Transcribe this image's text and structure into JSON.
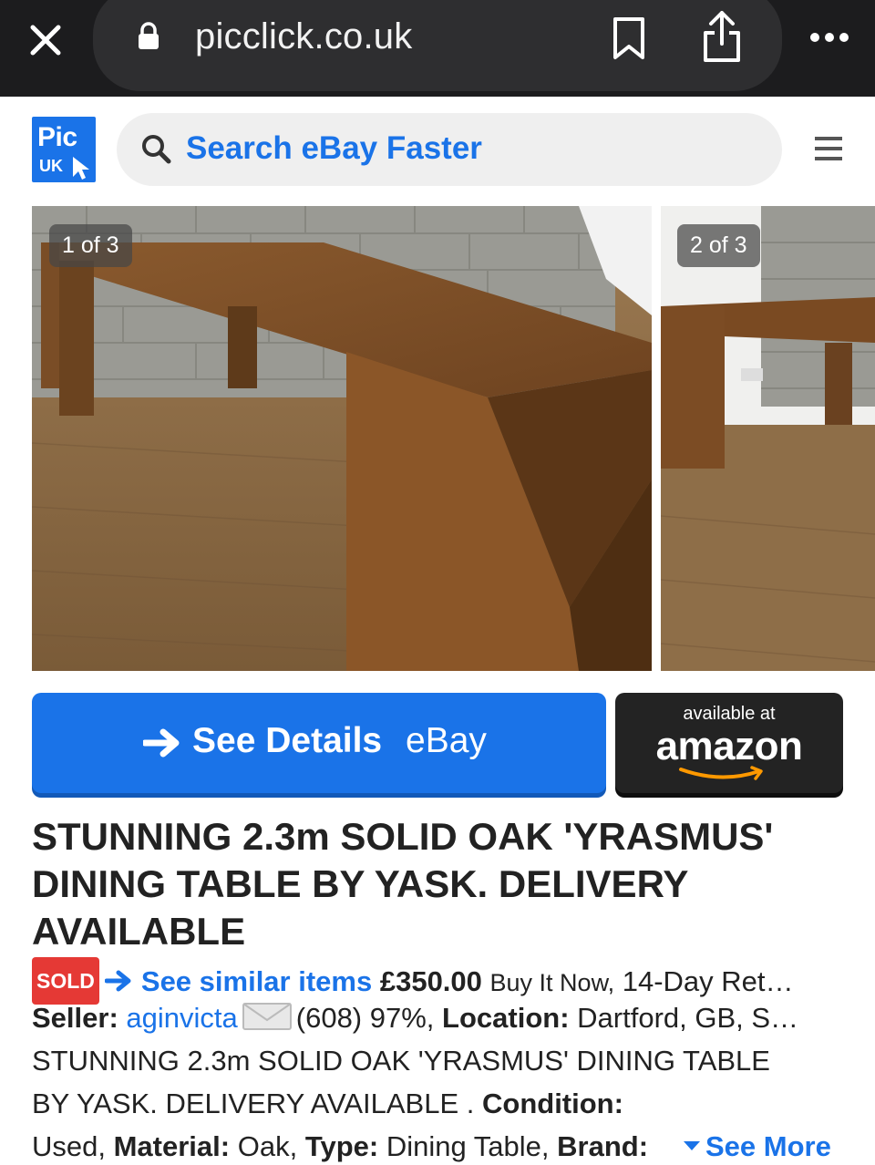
{
  "browser": {
    "url": "picclick.co.uk"
  },
  "header": {
    "logo_top": "Pic",
    "logo_bottom": "UK",
    "search_placeholder": "Search eBay Faster"
  },
  "gallery": {
    "photos": [
      {
        "counter": "1 of 3"
      },
      {
        "counter": "2 of 3"
      }
    ]
  },
  "actions": {
    "details_label": "See Details",
    "details_source": "eBay",
    "amazon_small": "available at",
    "amazon_logo": "amazon"
  },
  "listing": {
    "title": "STUNNING 2.3m SOLID OAK 'YRASMUS' DINING TABLE BY YASK. DELIVERY AVAILABLE",
    "sold_badge": "SOLD",
    "similar_link": "See similar items",
    "price": "£350.00",
    "buy_type": "Buy It Now,",
    "returns": "14-Day Ret…",
    "seller_label": "Seller:",
    "seller_name": "aginvicta",
    "feedback": "(608) 97%,",
    "location_label": "Location:",
    "location_value": "Dartford, GB, S…",
    "desc_line_1": "STUNNING 2.3m SOLID OAK 'YRASMUS' DINING TABLE",
    "desc_line_2": "BY YASK. DELIVERY AVAILABLE .",
    "condition_label": "Condition:",
    "condition_value": "Used,",
    "material_label": "Material:",
    "material_value": "Oak,",
    "type_label": "Type:",
    "type_value": "Dining Table,",
    "brand_label": "Brand:",
    "see_more": "See More"
  },
  "colors": {
    "brand_blue": "#1a73e8",
    "sold_red": "#e53935",
    "browser_bar": "#1c1c1e",
    "amazon_orange": "#ff9900"
  },
  "icons": [
    "close-icon",
    "lock-icon",
    "bookmark-icon",
    "share-icon",
    "more-icon",
    "search-icon",
    "menu-icon",
    "arrow-right-icon",
    "mail-icon",
    "chevron-down-icon"
  ]
}
